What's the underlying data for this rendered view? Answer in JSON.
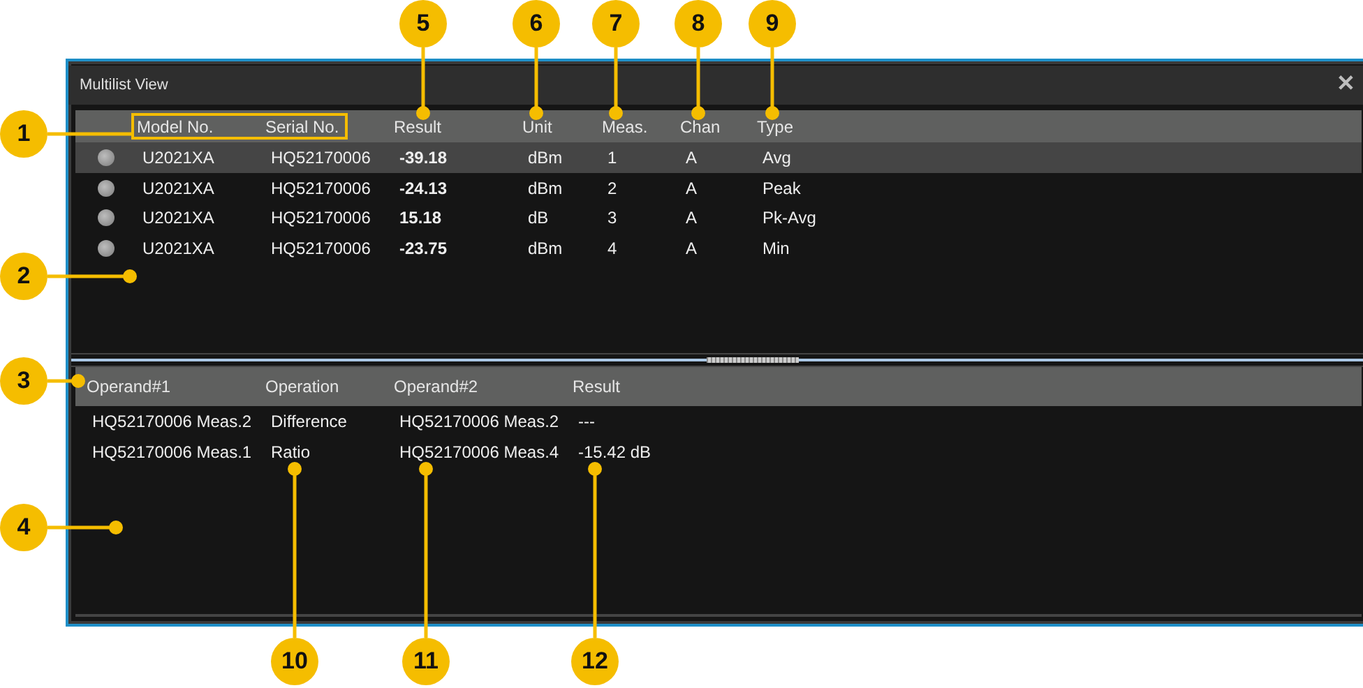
{
  "window": {
    "title": "Multilist View",
    "close": "✕"
  },
  "measurements": {
    "columns": [
      "Model No.",
      "Serial No.",
      "Result",
      "Unit",
      "Meas.",
      "Chan",
      "Type"
    ],
    "rows": [
      {
        "selected": true,
        "cells": [
          "U2021XA",
          "HQ52170006",
          "-39.18",
          "dBm",
          "1",
          "A",
          "Avg"
        ]
      },
      {
        "selected": false,
        "cells": [
          "U2021XA",
          "HQ52170006",
          "-24.13",
          "dBm",
          "2",
          "A",
          "Peak"
        ]
      },
      {
        "selected": false,
        "cells": [
          "U2021XA",
          "HQ52170006",
          "15.18",
          "dB",
          "3",
          "A",
          "Pk-Avg"
        ]
      },
      {
        "selected": false,
        "cells": [
          "U2021XA",
          "HQ52170006",
          "-23.75",
          "dBm",
          "4",
          "A",
          "Min"
        ]
      }
    ]
  },
  "math": {
    "columns": [
      "Operand#1",
      "Operation",
      "Operand#2",
      "Result"
    ],
    "rows": [
      {
        "cells": [
          "HQ52170006 Meas.2",
          "Difference",
          "HQ52170006 Meas.2",
          "---"
        ]
      },
      {
        "cells": [
          "HQ52170006 Meas.1",
          "Ratio",
          "HQ52170006 Meas.4",
          "-15.42 dB"
        ]
      }
    ]
  },
  "callouts": [
    "1",
    "2",
    "3",
    "4",
    "5",
    "6",
    "7",
    "8",
    "9",
    "10",
    "11",
    "12"
  ]
}
